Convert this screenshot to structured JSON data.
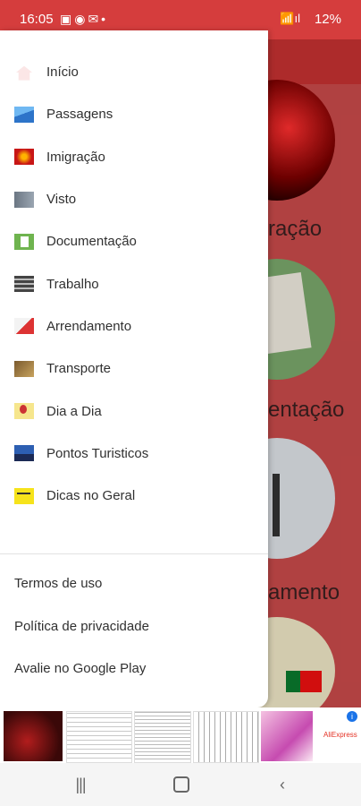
{
  "status_bar": {
    "time": "16:05",
    "notification_icons": [
      "gallery-icon",
      "whatsapp-icon",
      "mail-icon",
      "dot-icon"
    ],
    "battery": "12%"
  },
  "background": {
    "labels": [
      "ração",
      "entação",
      "amento"
    ]
  },
  "drawer": {
    "menu": [
      {
        "label": "Início",
        "icon": "home-icon"
      },
      {
        "label": "Passagens",
        "icon": "plane-icon"
      },
      {
        "label": "Imigração",
        "icon": "immigration-icon"
      },
      {
        "label": "Visto",
        "icon": "visa-icon"
      },
      {
        "label": "Documentação",
        "icon": "document-icon"
      },
      {
        "label": "Trabalho",
        "icon": "work-icon"
      },
      {
        "label": "Arrendamento",
        "icon": "rent-icon"
      },
      {
        "label": "Transporte",
        "icon": "transport-icon"
      },
      {
        "label": "Dia a Dia",
        "icon": "daily-icon"
      },
      {
        "label": "Pontos Turisticos",
        "icon": "tourism-icon"
      },
      {
        "label": "Dicas no Geral",
        "icon": "tips-icon"
      }
    ],
    "links": [
      {
        "label": "Termos de uso"
      },
      {
        "label": "Política de privacidade"
      },
      {
        "label": "Avalie no Google Play"
      }
    ]
  },
  "ad": {
    "brand": "AliExpress",
    "info": "i"
  },
  "nav_bar": {
    "recent": "|||",
    "back": "‹"
  }
}
